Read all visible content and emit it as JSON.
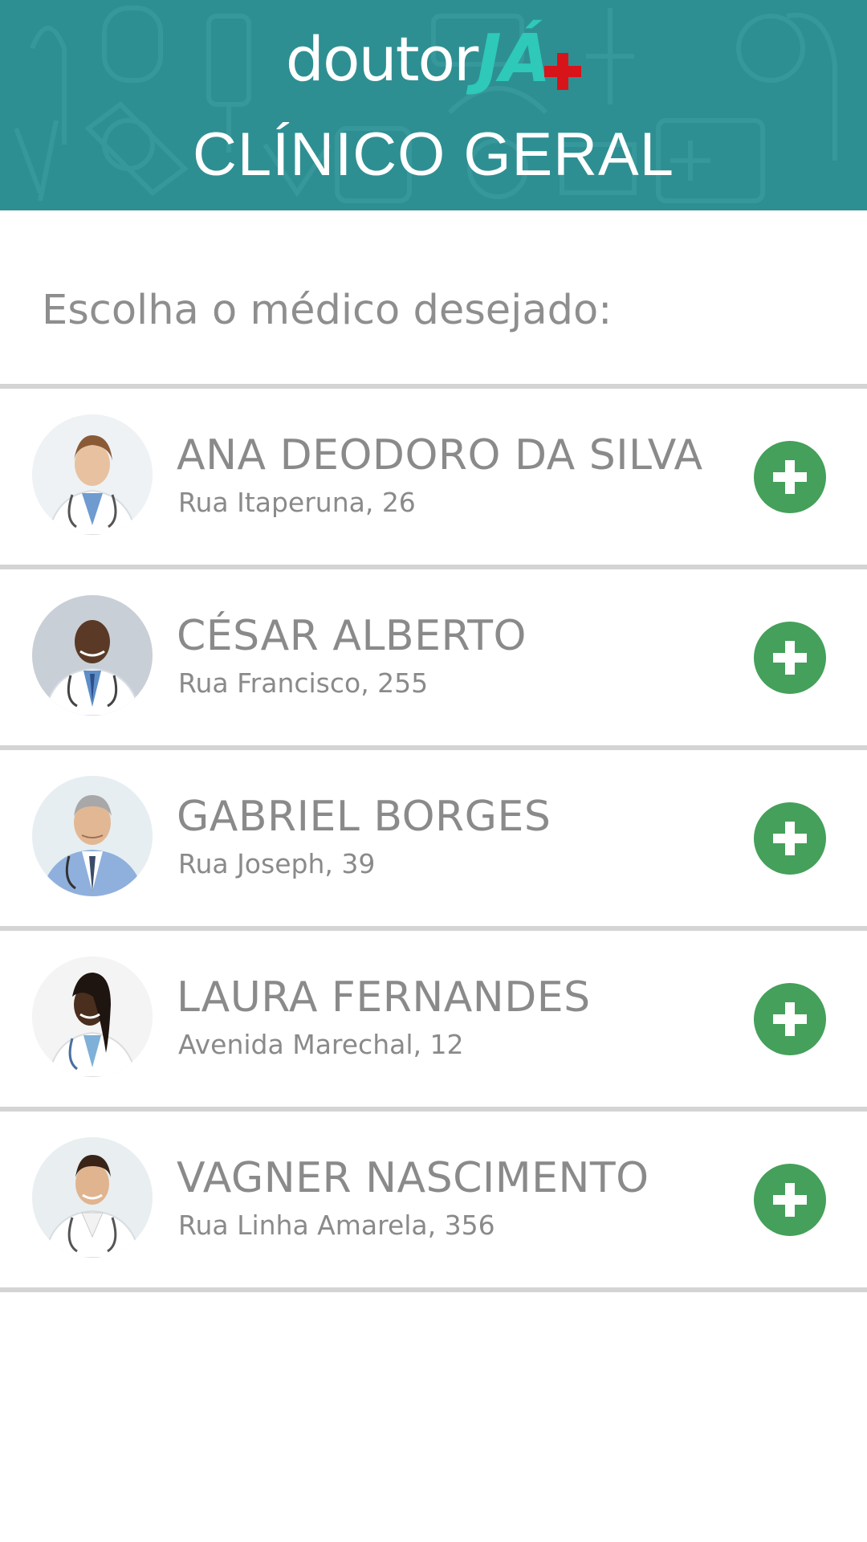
{
  "header": {
    "logo_word": "doutor",
    "logo_accent": "JÁ",
    "title": "CLÍNICO GERAL",
    "background_color": "#2e8f92"
  },
  "prompt": "Escolha o médico desejado:",
  "doctors": [
    {
      "name": "ANA DEODORO DA SILVA",
      "address": "Rua Itaperuna, 26",
      "avatar_icon": "female-doctor-photo",
      "action_icon": "plus-icon"
    },
    {
      "name": "CÉSAR ALBERTO",
      "address": "Rua Francisco, 255",
      "avatar_icon": "male-doctor-photo",
      "action_icon": "plus-icon"
    },
    {
      "name": "GABRIEL BORGES",
      "address": "Rua Joseph, 39",
      "avatar_icon": "male-doctor-photo",
      "action_icon": "plus-icon"
    },
    {
      "name": "LAURA FERNANDES",
      "address": "Avenida Marechal, 12",
      "avatar_icon": "female-doctor-photo",
      "action_icon": "plus-icon"
    },
    {
      "name": "VAGNER NASCIMENTO",
      "address": "Rua Linha Amarela, 356",
      "avatar_icon": "male-doctor-photo",
      "action_icon": "plus-icon"
    }
  ],
  "colors": {
    "accent_green": "#44a05a",
    "text_gray": "#8a8a8a",
    "divider": "#d4d4d4",
    "logo_teal": "#2ec9b8",
    "logo_red": "#d7141a"
  }
}
